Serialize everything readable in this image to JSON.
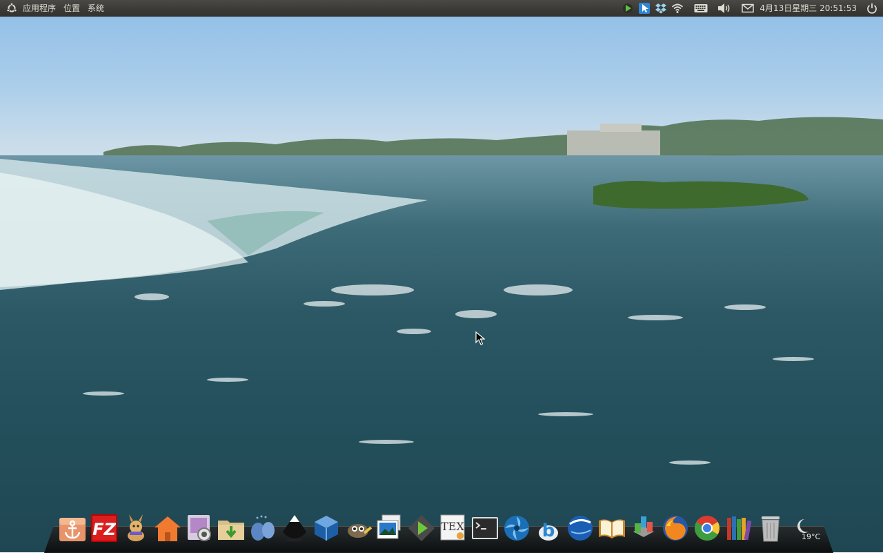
{
  "top_panel": {
    "menus": [
      "应用程序",
      "位置",
      "系统"
    ],
    "clock": "4月13日星期三 20:51:53",
    "tray_icons": [
      "play-icon",
      "cursor-app-icon",
      "dropbox-icon",
      "wifi-icon",
      "keyboard-icon",
      "volume-icon",
      "mail-icon",
      "power-icon"
    ]
  },
  "dock": {
    "items": [
      "anchor-app-icon",
      "filezilla-icon",
      "mascot-icon",
      "home-folder-icon",
      "screenshot-tool-icon",
      "download-folder-icon",
      "pidgin-icon",
      "inkscape-icon",
      "virtualbox-icon",
      "gimp-icon",
      "image-viewer-icon",
      "media-player-icon",
      "tex-editor-icon",
      "terminal-icon",
      "shutter-icon",
      "bing-icon",
      "google-earth-icon",
      "dictionary-icon",
      "package-manager-icon",
      "firefox-icon",
      "chrome-icon",
      "books-icon",
      "trash-icon",
      "weather-icon"
    ],
    "weather_temp": "19°C"
  },
  "colors": {
    "panel": "#3c3b37",
    "sky": "#a9cdea",
    "water": "#2c5865"
  }
}
